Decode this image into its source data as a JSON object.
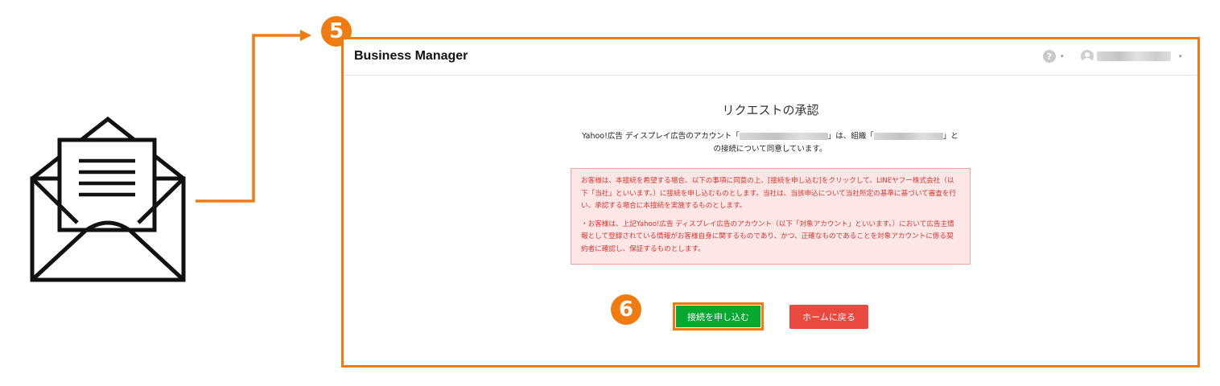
{
  "colors": {
    "highlight": "#f07c11",
    "connect_button": "#07a82f",
    "home_button": "#e9493f",
    "notice_background": "#fde6e6",
    "notice_text": "#d9362e"
  },
  "steps": {
    "step5": "5",
    "step6": "6"
  },
  "icons": {
    "envelope": "open-envelope-icon",
    "help": "help-icon",
    "avatar": "user-avatar-icon"
  },
  "header": {
    "brand": "Business Manager",
    "help_symbol": "?",
    "caret": "▾"
  },
  "page": {
    "title": "リクエストの承認",
    "message_part1": "Yahoo!広告 ディスプレイ広告のアカウント「",
    "message_part2": "」は、組織「",
    "message_part3": "」と",
    "message_line2": "の接続について同意しています。"
  },
  "notice": {
    "paragraph1": "お客様は、本接続を希望する場合、以下の事項に同意の上、[接続を申し込む]をクリックして、LINEヤフー株式会社（以下「当社」といいます。）に接続を申し込むものとします。当社は、当該申込について当社所定の基準に基づいて審査を行い、承認する場合に本接続を実施するものとします。",
    "paragraph2": "・お客様は、上記Yahoo!広告 ディスプレイ広告のアカウント（以下「対象アカウント」といいます。）において広告主情報として登録されている情報がお客様自身に関するものであり、かつ、正確なものであることを対象アカウントに係る契約者に確認し、保証するものとします。"
  },
  "buttons": {
    "connect": "接続を申し込む",
    "home": "ホームに戻る"
  }
}
